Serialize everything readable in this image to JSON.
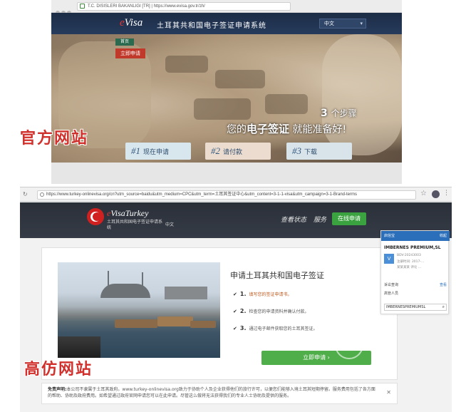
{
  "official": {
    "url": "T.C. DISISLERI BAKANLIGI [TR] | https://www.evisa.gov.tr/zh/",
    "logo_e": "e",
    "logo_rest": "Visa",
    "title": "土耳其共和国电子签证申请系统",
    "language": "中文",
    "menu_small": "首页",
    "menu_apply": "立即申请",
    "steps_num": "3",
    "steps_word": "个步骤",
    "tagline_pre": "您的",
    "tagline_hl": "电子签证",
    "tagline_post": " 就能准备好!",
    "steps": [
      {
        "no": "#1",
        "label": "现在申请"
      },
      {
        "no": "#2",
        "label": "请付款"
      },
      {
        "no": "#3",
        "label": "下载"
      }
    ]
  },
  "labels": {
    "official_site": "官方网站",
    "fake_site": "高仿网站"
  },
  "fake": {
    "url": "https://www.turkey-onlinevisa.org/cn?utm_source=baidu&utm_medium=CPC&utm_term=土耳其签证中心&utm_content=3-1-1-visa&utm_campaign=3-1-Brand-terms",
    "brand_e": "e",
    "brand_rest": "VisaTurkey",
    "brand_sub": "土耳其共和国电子签证申请系统",
    "lang": "中文",
    "nav_status": "查看状态",
    "nav_service": "服务",
    "nav_apply": "在线申请",
    "card_title": "申请土耳其共和国电子签证",
    "steps": [
      {
        "num": "1.",
        "text": "填写您的签证申请书。"
      },
      {
        "num": "2.",
        "text": "检查您的申请资料并确认付款。"
      },
      {
        "num": "3.",
        "text": "通过电子邮件获取您的土耳其签证。"
      }
    ],
    "cta": "立即申请 ›",
    "disclaimer_bold": "免责声明:",
    "disclaimer": "本公司不隶属于土耳其政府。www.turkey-onlinevisa.org致力于协助个人及企业获得他们的旅行许可，以便您们能够入境土耳其短期停留。服务费用包括了各方面的帮助、协助及政府费用。如希望通过政府官网申请您可以在此申请。尽管这么做将无法获得我们的专业人士协助及提供的服务。",
    "popup": {
      "header": "启信宝",
      "header_right": "收起",
      "company": "IMBERNES PREMIUM,SL",
      "line1": "BDV-20243003",
      "line2": "注册时间: 2017-...",
      "line3": "某某某某 评论 ...",
      "row1": "诉讼查询",
      "row1_r": "查看",
      "row2": "高管人员",
      "search": "IMBERNESPREMIUMSL"
    }
  },
  "watermark": "冰"
}
